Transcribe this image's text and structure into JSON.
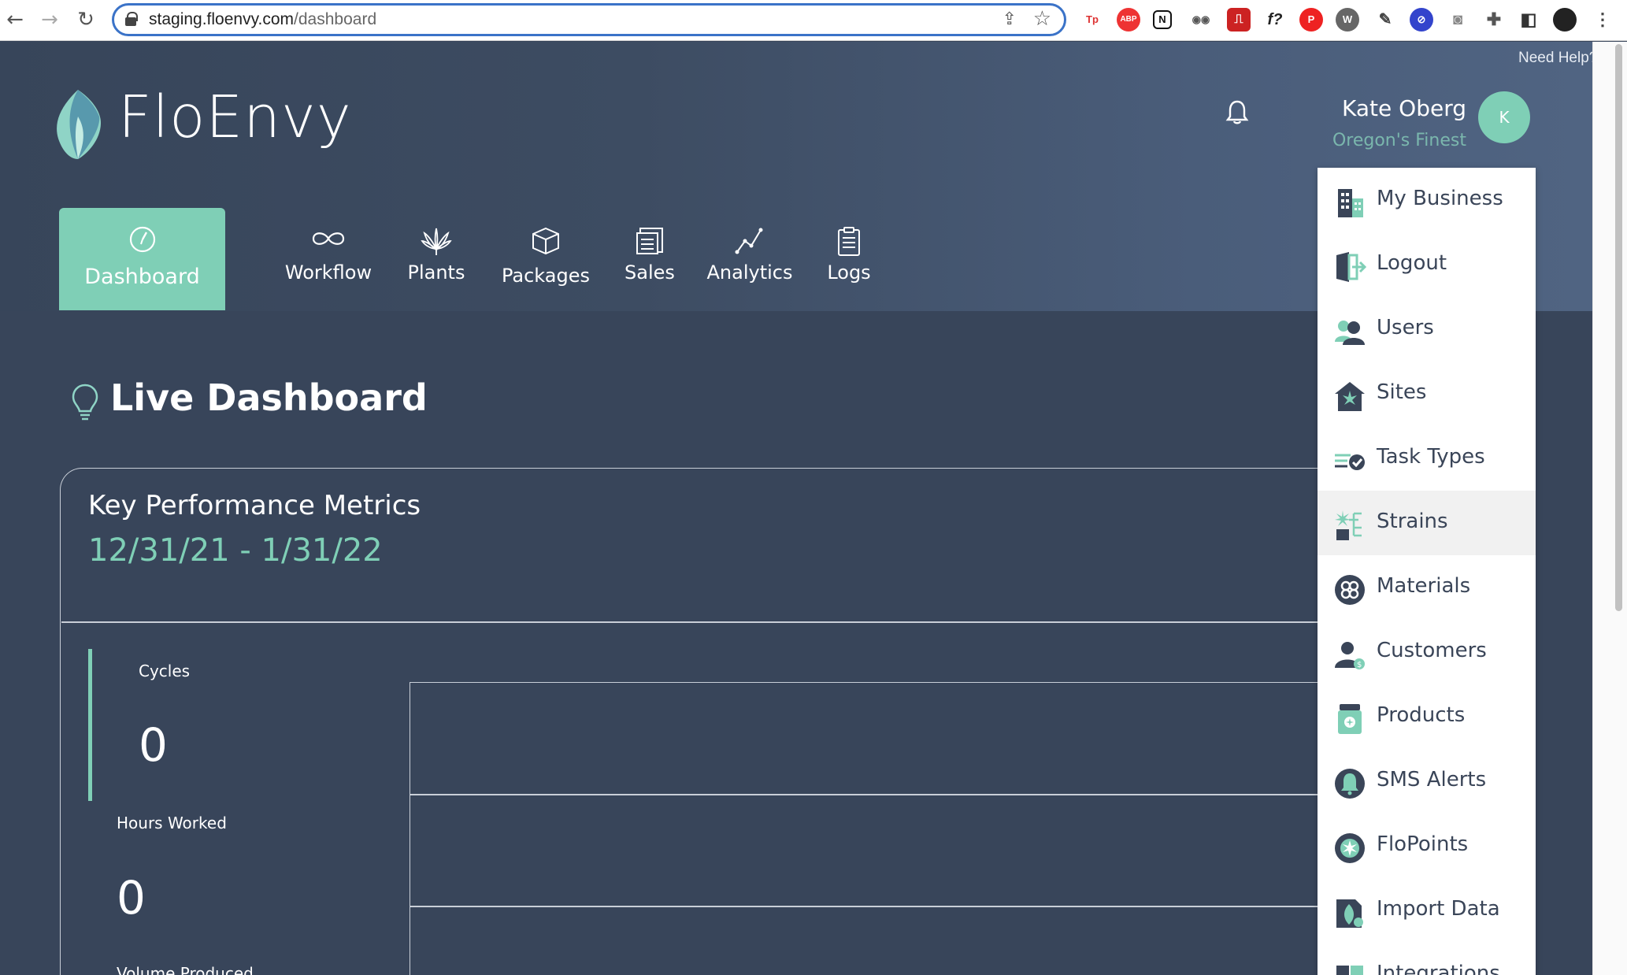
{
  "browser": {
    "url_host": "staging.floenvy.com",
    "url_path": "/dashboard"
  },
  "header": {
    "need_help": "Need Help?",
    "logo_text": "FloEnvy",
    "user_name": "Kate Oberg",
    "user_org": "Oregon's Finest",
    "avatar_initial": "K"
  },
  "nav": {
    "tabs": [
      {
        "label": "Dashboard",
        "icon": "gauge-icon",
        "active": true
      },
      {
        "label": "Workflow",
        "icon": "infinity-icon"
      },
      {
        "label": "Plants",
        "icon": "cannabis-leaf-icon"
      },
      {
        "label": "Packages",
        "icon": "box-icon"
      },
      {
        "label": "Sales",
        "icon": "receipt-icon"
      },
      {
        "label": "Analytics",
        "icon": "line-graph-icon"
      },
      {
        "label": "Logs",
        "icon": "clipboard-icon"
      }
    ]
  },
  "main": {
    "title": "Live Dashboard",
    "kpi": {
      "title": "Key Performance Metrics",
      "date_range": "12/31/21 - 1/31/22",
      "metrics": [
        {
          "label": "Cycles",
          "value": "0"
        },
        {
          "label": "Hours Worked",
          "value": "0"
        },
        {
          "label": "Volume Produced",
          "value": ""
        }
      ]
    }
  },
  "dropdown": {
    "items": [
      {
        "label": "My Business",
        "icon": "building-icon"
      },
      {
        "label": "Logout",
        "icon": "logout-door-icon"
      },
      {
        "label": "Users",
        "icon": "users-icon"
      },
      {
        "label": "Sites",
        "icon": "site-house-icon"
      },
      {
        "label": "Task Types",
        "icon": "task-check-icon"
      },
      {
        "label": "Strains",
        "icon": "strain-tree-icon",
        "hover": true
      },
      {
        "label": "Materials",
        "icon": "materials-icon"
      },
      {
        "label": "Customers",
        "icon": "customer-icon"
      },
      {
        "label": "Products",
        "icon": "product-jar-icon"
      },
      {
        "label": "SMS Alerts",
        "icon": "bell-alert-icon"
      },
      {
        "label": "FloPoints",
        "icon": "flopoints-icon"
      },
      {
        "label": "Import Data",
        "icon": "import-icon"
      },
      {
        "label": "Integrations",
        "icon": "integrations-icon"
      }
    ]
  },
  "colors": {
    "accent": "#7fcfb6",
    "background": "#38455a",
    "text_dark": "#3a4558"
  }
}
